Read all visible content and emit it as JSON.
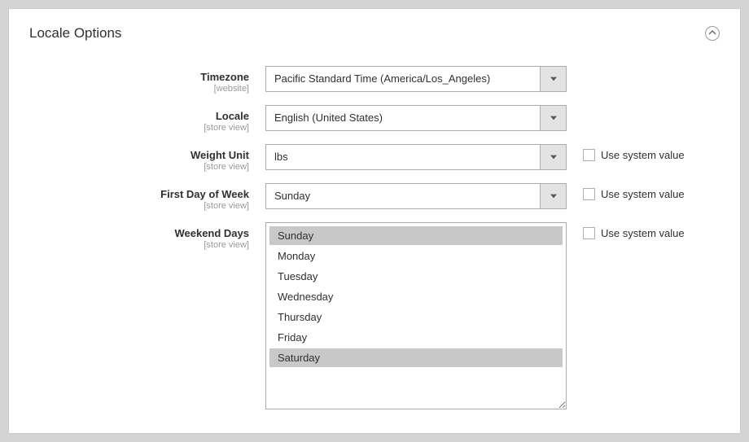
{
  "section": {
    "title": "Locale Options"
  },
  "fields": {
    "timezone": {
      "label": "Timezone",
      "scope": "[website]",
      "value": "Pacific Standard Time (America/Los_Angeles)"
    },
    "locale": {
      "label": "Locale",
      "scope": "[store view]",
      "value": "English (United States)"
    },
    "weight_unit": {
      "label": "Weight Unit",
      "scope": "[store view]",
      "value": "lbs",
      "use_system_label": "Use system value"
    },
    "first_day": {
      "label": "First Day of Week",
      "scope": "[store view]",
      "value": "Sunday",
      "use_system_label": "Use system value"
    },
    "weekend_days": {
      "label": "Weekend Days",
      "scope": "[store view]",
      "use_system_label": "Use system value",
      "options": [
        {
          "label": "Sunday",
          "selected": true
        },
        {
          "label": "Monday",
          "selected": false
        },
        {
          "label": "Tuesday",
          "selected": false
        },
        {
          "label": "Wednesday",
          "selected": false
        },
        {
          "label": "Thursday",
          "selected": false
        },
        {
          "label": "Friday",
          "selected": false
        },
        {
          "label": "Saturday",
          "selected": true
        }
      ]
    }
  }
}
